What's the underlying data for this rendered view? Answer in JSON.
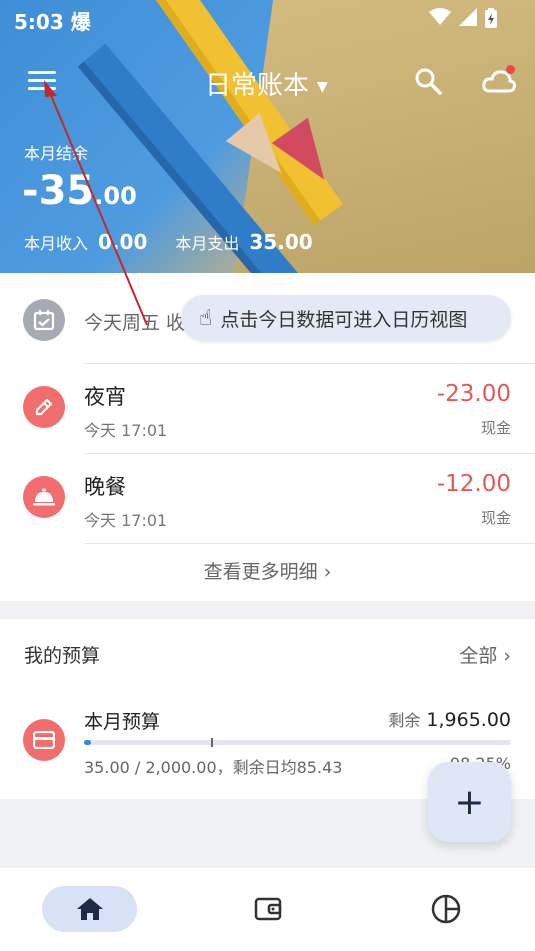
{
  "status_bar": {
    "time": "5:03",
    "badge": "爆"
  },
  "topbar": {
    "book_title": "日常账本"
  },
  "balance": {
    "label": "本月结余",
    "amount_main": "-35",
    "amount_decimal": ".00",
    "income_label": "本月收入",
    "income_value": "0.00",
    "expense_label": "本月支出",
    "expense_value": "35.00"
  },
  "today": {
    "text": "今天周五  收 0",
    "tooltip": "点击今日数据可进入日历视图"
  },
  "transactions": [
    {
      "name": "夜宵",
      "time": "今天 17:01",
      "amount": "-23.00",
      "account": "现金",
      "icon": "pencil-icon"
    },
    {
      "name": "晚餐",
      "time": "今天 17:01",
      "amount": "-12.00",
      "account": "现金",
      "icon": "cloche-icon"
    }
  ],
  "more_details": "查看更多明细 ›",
  "budget": {
    "title": "我的预算",
    "all_label": "全部 ›",
    "item": {
      "name": "本月预算",
      "remain_label": "剩余",
      "remain_value": "1,965.00",
      "detail": "35.00 / 2,000.00，剩余日均85.43",
      "pct": "98.25%",
      "used_fraction": 0.0175
    }
  },
  "fab_label": "+",
  "bottom_nav": [
    {
      "name": "home-icon",
      "active": true
    },
    {
      "name": "wallet-icon",
      "active": false
    },
    {
      "name": "pie-chart-icon",
      "active": false
    }
  ],
  "colors": {
    "accent": "#3d86e6",
    "expense": "#e05a5a",
    "icon_red": "#f26e6e",
    "annotation_arrow": "#c62828"
  }
}
